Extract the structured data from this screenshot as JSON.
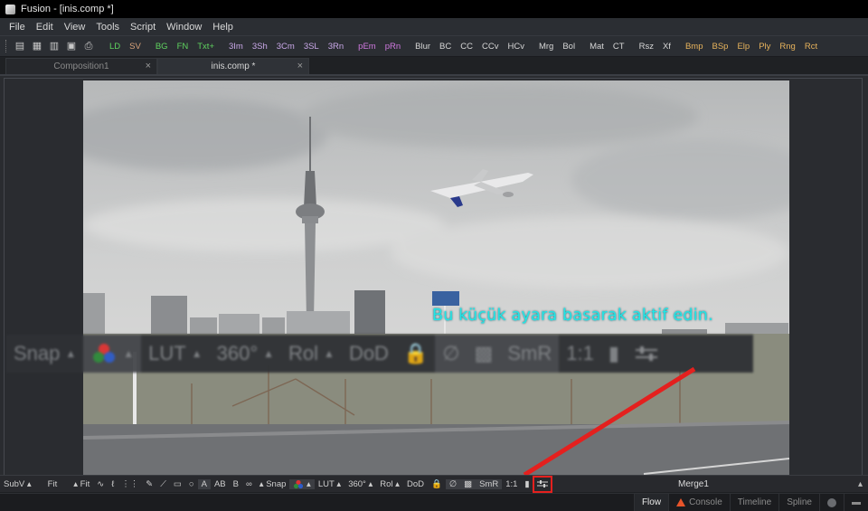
{
  "titlebar": {
    "title": "Fusion - [inis.comp *]"
  },
  "menu": {
    "items": [
      "File",
      "Edit",
      "View",
      "Tools",
      "Script",
      "Window",
      "Help"
    ]
  },
  "toolbar": {
    "tools": [
      {
        "label": "LD",
        "color": "#5fd35f"
      },
      {
        "label": "SV",
        "color": "#d8a27a"
      },
      {
        "label": "BG",
        "color": "#5fd35f"
      },
      {
        "label": "FN",
        "color": "#5fd35f"
      },
      {
        "label": "Txt+",
        "color": "#5fd35f"
      },
      {
        "label": "3Im",
        "color": "#c9a8e8"
      },
      {
        "label": "3Sh",
        "color": "#c9a8e8"
      },
      {
        "label": "3Cm",
        "color": "#c9a8e8"
      },
      {
        "label": "3SL",
        "color": "#c9a8e8"
      },
      {
        "label": "3Rn",
        "color": "#c9a8e8"
      },
      {
        "label": "pEm",
        "color": "#d079e0"
      },
      {
        "label": "pRn",
        "color": "#d079e0"
      },
      {
        "label": "Blur",
        "color": "#d6d6d6"
      },
      {
        "label": "BC",
        "color": "#d6d6d6"
      },
      {
        "label": "CC",
        "color": "#d6d6d6"
      },
      {
        "label": "CCv",
        "color": "#d6d6d6"
      },
      {
        "label": "HCv",
        "color": "#d6d6d6"
      },
      {
        "label": "Mrg",
        "color": "#d6d6d6"
      },
      {
        "label": "Bol",
        "color": "#d6d6d6"
      },
      {
        "label": "Mat",
        "color": "#d6d6d6"
      },
      {
        "label": "CT",
        "color": "#d6d6d6"
      },
      {
        "label": "Rsz",
        "color": "#d6d6d6"
      },
      {
        "label": "Xf",
        "color": "#d6d6d6"
      },
      {
        "label": "Bmp",
        "color": "#e7b35c"
      },
      {
        "label": "BSp",
        "color": "#e7b35c"
      },
      {
        "label": "Elp",
        "color": "#e7b35c"
      },
      {
        "label": "Ply",
        "color": "#e7b35c"
      },
      {
        "label": "Rng",
        "color": "#e7b35c"
      },
      {
        "label": "Rct",
        "color": "#e7b35c"
      }
    ]
  },
  "tabs": [
    {
      "label": "Composition1",
      "close": "×"
    },
    {
      "label": "inis.comp *",
      "close": "×"
    }
  ],
  "viewer": {
    "annotation": "Bu küçük ayara basarak aktif edin.",
    "annotation_color": "#20e6e6",
    "zoomed_toolbar": [
      "Snap",
      "LUT",
      "360°",
      "Rol",
      "DoD",
      "SmR",
      "1:1"
    ],
    "highlight_color": "#e4201e"
  },
  "bottombar": {
    "subv": "SubV",
    "fit1": "Fit",
    "fit2": "Fit",
    "a": "A",
    "ab": "AB",
    "b": "B",
    "snap": "Snap",
    "lut": "LUT",
    "deg": "360°",
    "rol": "Rol",
    "dod": "DoD",
    "smr": "SmR",
    "ratio": "1:1",
    "node": "Merge1"
  },
  "statusbar": {
    "flow": "Flow",
    "console": "Console",
    "timeline": "Timeline",
    "spline": "Spline"
  }
}
